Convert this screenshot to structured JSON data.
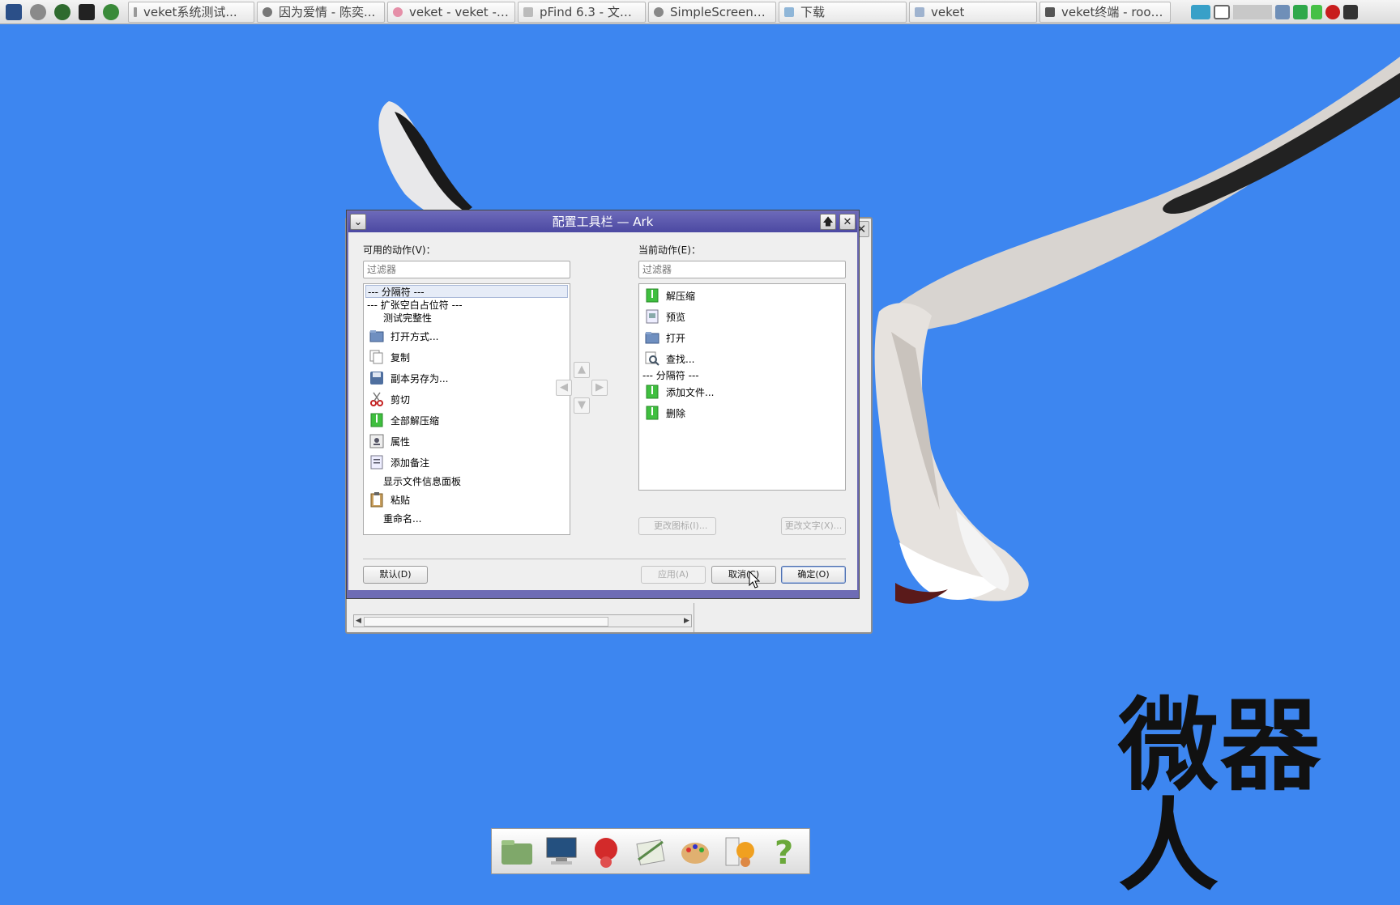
{
  "taskbar": {
    "launchers": [
      "system-monitor-icon",
      "settings-icon",
      "media-player-icon",
      "terminal-icon",
      "browser-icon"
    ],
    "tasks": [
      {
        "label": "veket系统测试...",
        "icon": "info-icon"
      },
      {
        "label": "因为爱情 - 陈奕...",
        "icon": "music-icon"
      },
      {
        "label": "veket - veket - v···",
        "icon": "browser-tab-icon"
      },
      {
        "label": "pFind 6.3 - 文件...",
        "icon": "search-app-icon"
      },
      {
        "label": "SimpleScreenR···",
        "icon": "record-icon"
      },
      {
        "label": "下载",
        "icon": "camera-icon"
      },
      {
        "label": "veket",
        "icon": "folder-icon"
      },
      {
        "label": "veket终端 - root···",
        "icon": "terminal-icon"
      }
    ]
  },
  "dialog": {
    "title": "配置工具栏 — Ark",
    "available_label": "可用的动作(V)：",
    "current_label": "当前动作(E)：",
    "filter_placeholder": "过滤器",
    "available_actions": [
      {
        "label": "--- 分隔符 ---",
        "icon": "",
        "selected": true
      },
      {
        "label": "--- 扩张空白占位符 ---",
        "icon": ""
      },
      {
        "label": "测试完整性",
        "icon": ""
      },
      {
        "label": "打开方式...",
        "icon": "folder-open-icon"
      },
      {
        "label": "复制",
        "icon": "copy-icon"
      },
      {
        "label": "副本另存为...",
        "icon": "save-as-icon"
      },
      {
        "label": "剪切",
        "icon": "scissors-icon"
      },
      {
        "label": "全部解压缩",
        "icon": "archive-icon"
      },
      {
        "label": "属性",
        "icon": "properties-icon"
      },
      {
        "label": "添加备注",
        "icon": "note-icon"
      },
      {
        "label": "显示文件信息面板",
        "icon": ""
      },
      {
        "label": "粘贴",
        "icon": "clipboard-icon"
      },
      {
        "label": "重命名...",
        "icon": ""
      }
    ],
    "current_actions": [
      {
        "label": "解压缩",
        "icon": "archive-icon"
      },
      {
        "label": "预览",
        "icon": "preview-icon"
      },
      {
        "label": "打开",
        "icon": "folder-open-icon"
      },
      {
        "label": "查找...",
        "icon": "find-icon"
      },
      {
        "label": "--- 分隔符 ---",
        "icon": ""
      },
      {
        "label": "添加文件...",
        "icon": "archive-icon"
      },
      {
        "label": "删除",
        "icon": "archive-icon"
      }
    ],
    "change_icon_label": "更改图标(I)...",
    "change_text_label": "更改文字(X)...",
    "default_label": "默认(D)",
    "apply_label": "应用(A)",
    "cancel_label": "取消(C)",
    "ok_label": "确定(O)"
  },
  "desktop": {
    "brand_text": "微器人"
  }
}
